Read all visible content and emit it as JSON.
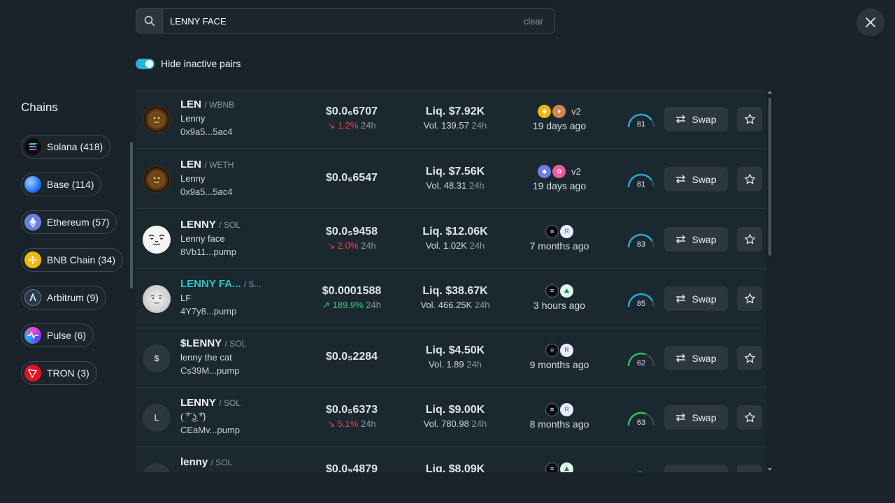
{
  "search": {
    "value": "LENNY FACE",
    "clear_label": "clear"
  },
  "filter": {
    "hide_inactive_label": "Hide inactive pairs",
    "hide_inactive_on": true
  },
  "sidebar": {
    "title": "Chains",
    "chains": [
      {
        "label": "Solana (418)",
        "icon": "solana-icon"
      },
      {
        "label": "Base (114)",
        "icon": "base-icon"
      },
      {
        "label": "Ethereum (57)",
        "icon": "ethereum-icon"
      },
      {
        "label": "BNB Chain (34)",
        "icon": "bnb-icon"
      },
      {
        "label": "Arbitrum (9)",
        "icon": "arbitrum-icon"
      },
      {
        "label": "Pulse (6)",
        "icon": "pulse-icon"
      },
      {
        "label": "TRON (3)",
        "icon": "tron-icon"
      }
    ]
  },
  "swap_label": "Swap",
  "rows": [
    {
      "symbol": "LEN",
      "quote": "/ WBNB",
      "name": "Lenny",
      "address": "0x9a5...5ac4",
      "price": "$0.0₆6707",
      "change": "1.2%",
      "change_dir": "down",
      "change_period": "24h",
      "liquidity": "Liq. $7.92K",
      "volume": "Vol. 139.57",
      "volume_period": "24h",
      "dex_version": "v2",
      "age": "19 days ago",
      "score": "81"
    },
    {
      "symbol": "LEN",
      "quote": "/ WETH",
      "name": "Lenny",
      "address": "0x9a5...5ac4",
      "price": "$0.0₆6547",
      "change": "",
      "change_dir": "none",
      "change_period": "",
      "liquidity": "Liq. $7.56K",
      "volume": "Vol. 48.31",
      "volume_period": "24h",
      "dex_version": "v2",
      "age": "19 days ago",
      "score": "81"
    },
    {
      "symbol": "LENNY",
      "quote": "/ SOL",
      "name": "Lenny face",
      "address": "8Vb11...pump",
      "price": "$0.0₅9458",
      "change": "2.0%",
      "change_dir": "down",
      "change_period": "24h",
      "liquidity": "Liq. $12.06K",
      "volume": "Vol. 1.02K",
      "volume_period": "24h",
      "dex_version": "",
      "age": "7 months ago",
      "score": "83"
    },
    {
      "symbol": "LENNY FA...",
      "quote": "/ S...",
      "name": "LF",
      "address": "4Y7y8...pump",
      "price": "$0.0001588",
      "change": "189.9%",
      "change_dir": "up",
      "change_period": "24h",
      "liquidity": "Liq. $38.67K",
      "volume": "Vol. 466.25K",
      "volume_period": "24h",
      "dex_version": "",
      "age": "3 hours ago",
      "score": "85"
    },
    {
      "symbol": "$LENNY",
      "quote": "/ SOL",
      "name": "lenny the cat",
      "address": "Cs39M...pump",
      "price": "$0.0₅2284",
      "change": "",
      "change_dir": "none",
      "change_period": "",
      "liquidity": "Liq. $4.50K",
      "volume": "Vol. 1.89",
      "volume_period": "24h",
      "dex_version": "",
      "age": "9 months ago",
      "score": "62",
      "avatar_text": "$"
    },
    {
      "symbol": "LENNY",
      "quote": "/ SOL",
      "name": "( ͡° ͜ʖ ͡°)",
      "address": "CEaMv...pump",
      "price": "$0.0₅6373",
      "change": "5.1%",
      "change_dir": "down",
      "change_period": "24h",
      "liquidity": "Liq. $9.00K",
      "volume": "Vol. 780.98",
      "volume_period": "24h",
      "dex_version": "",
      "age": "8 months ago",
      "score": "63",
      "avatar_text": "L"
    },
    {
      "symbol": "lenny",
      "quote": "/ SOL",
      "name": "",
      "address": "",
      "price": "$0.0₅4879",
      "change": "",
      "change_dir": "none",
      "change_period": "",
      "liquidity": "Liq. $8.09K",
      "volume": "",
      "volume_period": "",
      "dex_version": "",
      "age": "",
      "score": ""
    }
  ],
  "colors": {
    "accent": "#24b5d4",
    "up": "#2fcf77",
    "down": "#e8414b",
    "gauge_blue": "#2aa7d3",
    "gauge_green": "#2fbf5a"
  }
}
